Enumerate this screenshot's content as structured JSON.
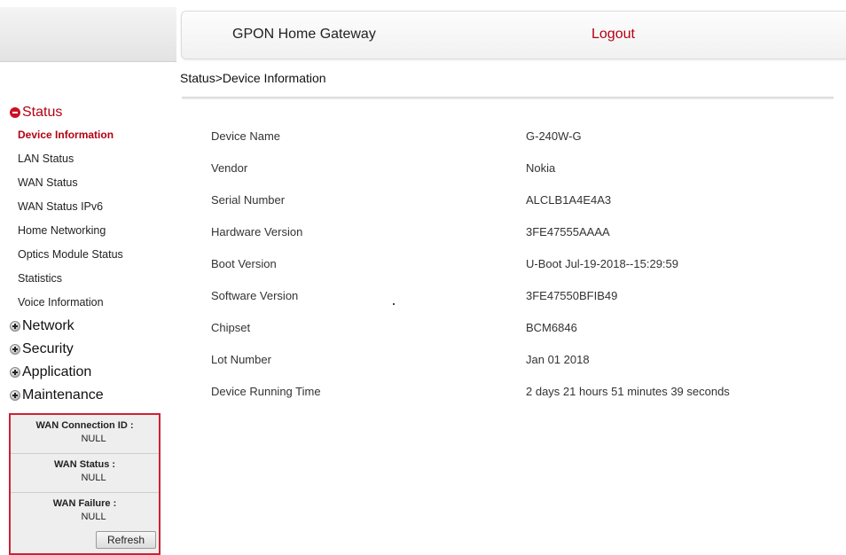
{
  "header": {
    "title": "GPON Home Gateway",
    "logout_label": "Logout"
  },
  "breadcrumb": "Status>Device Information",
  "sidebar": {
    "status_group": {
      "label": "Status",
      "icon": "minus-circle-icon",
      "items": [
        {
          "label": "Device Information",
          "active": true
        },
        {
          "label": "LAN Status"
        },
        {
          "label": "WAN Status"
        },
        {
          "label": "WAN Status IPv6"
        },
        {
          "label": "Home Networking"
        },
        {
          "label": "Optics Module Status"
        },
        {
          "label": "Statistics"
        },
        {
          "label": "Voice Information"
        }
      ]
    },
    "groups": [
      {
        "label": "Network",
        "icon": "plus-circle-icon"
      },
      {
        "label": "Security",
        "icon": "plus-circle-icon"
      },
      {
        "label": "Application",
        "icon": "plus-circle-icon"
      },
      {
        "label": "Maintenance",
        "icon": "plus-circle-icon"
      }
    ]
  },
  "wan_panel": {
    "connection_id_label": "WAN Connection ID :",
    "connection_id_value": "NULL",
    "status_label": "WAN Status :",
    "status_value": "NULL",
    "failure_label": "WAN Failure :",
    "failure_value": "NULL",
    "refresh_label": "Refresh"
  },
  "device_info": [
    {
      "key": "Device Name",
      "value": "G-240W-G"
    },
    {
      "key": "Vendor",
      "value": "Nokia"
    },
    {
      "key": "Serial Number",
      "value": "ALCLB1A4E4A3"
    },
    {
      "key": "Hardware Version",
      "value": "3FE47555AAAA"
    },
    {
      "key": "Boot Version",
      "value": "U-Boot Jul-19-2018--15:29:59"
    },
    {
      "key": "Software Version",
      "value": "3FE47550BFIB49"
    },
    {
      "key": "Chipset",
      "value": "BCM6846"
    },
    {
      "key": "Lot Number",
      "value": "Jan 01 2018"
    },
    {
      "key": "Device Running Time",
      "value": "2 days 21 hours 51 minutes 39 seconds"
    }
  ],
  "colors": {
    "accent": "#b40012",
    "panel_border": "#cc2233"
  }
}
